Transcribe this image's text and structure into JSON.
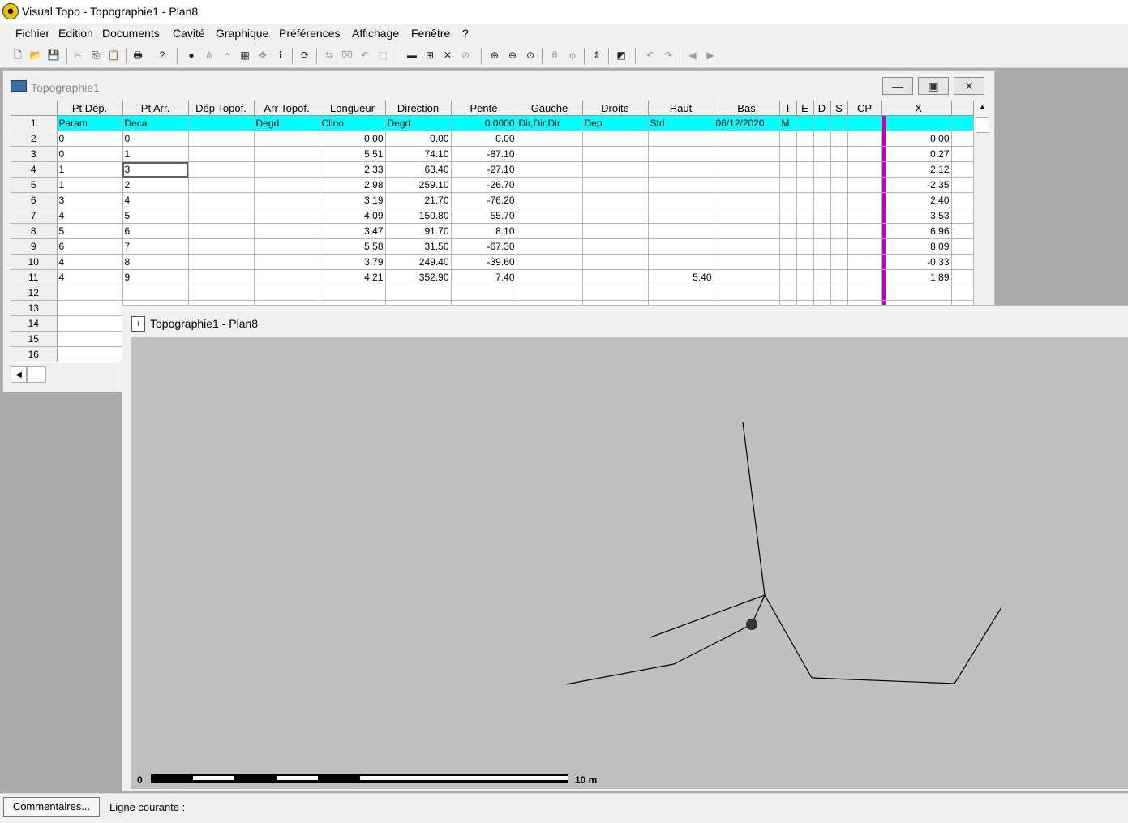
{
  "app": {
    "title": "Visual Topo - Topographie1 - Plan8",
    "icon": "app-logo-icon"
  },
  "menu": [
    "Fichier",
    "Edition",
    "Documents",
    "Cavité",
    "Graphique",
    "Préférences",
    "Affichage",
    "Fenêtre",
    "?"
  ],
  "toolbar_icons": [
    "new-file-icon",
    "open-folder-icon",
    "save-icon",
    "cut-icon",
    "copy-icon",
    "paste-icon",
    "print-icon",
    "help-icon",
    "globe-icon",
    "tree-icon",
    "export-icon",
    "table-icon",
    "move-icon",
    "info-icon",
    "refresh-icon",
    "swap-icon",
    "delete-icon",
    "undo-branch-icon",
    "frame-icon",
    "line-icon",
    "properties-icon",
    "close-x-icon",
    "search-icon",
    "zoom-in-icon",
    "zoom-out-icon",
    "zoom-fit-icon",
    "theta-icon",
    "phi-icon",
    "vertical-arrow-icon",
    "chart-icon",
    "undo-icon",
    "redo-icon",
    "arrow-left-icon",
    "arrow-right-icon"
  ],
  "data_window": {
    "title": "Topographie1",
    "columns": [
      "",
      "Pt Dép.",
      "Pt Arr.",
      "Dép Topof.",
      "Arr Topof.",
      "Longueur",
      "Direction",
      "Pente",
      "Gauche",
      "Droite",
      "Haut",
      "Bas",
      "I",
      "E",
      "D",
      "S",
      "CP",
      "",
      "X",
      ""
    ],
    "rows": [
      {
        "n": "1",
        "dep": "Param",
        "arr": "Deca",
        "dtop": "",
        "atop": "Degd",
        "long": "Clino",
        "dir": "Degd",
        "pente": "0.0000",
        "gauche": "Dir,Dir,Dir",
        "droite": "Dep",
        "haut": "Std",
        "bas": "06/12/2020",
        "i": "M",
        "x": ""
      },
      {
        "n": "2",
        "dep": "0",
        "arr": "0",
        "dtop": "",
        "atop": "",
        "long": "0.00",
        "dir": "0.00",
        "pente": "0.00",
        "gauche": "",
        "droite": "",
        "haut": "",
        "bas": "",
        "i": "",
        "x": "0.00"
      },
      {
        "n": "3",
        "dep": "0",
        "arr": "1",
        "dtop": "",
        "atop": "",
        "long": "5.51",
        "dir": "74.10",
        "pente": "-87.10",
        "gauche": "",
        "droite": "",
        "haut": "",
        "bas": "",
        "i": "",
        "x": "0.27"
      },
      {
        "n": "4",
        "dep": "1",
        "arr": "3",
        "dtop": "",
        "atop": "",
        "long": "2.33",
        "dir": "63.40",
        "pente": "-27.10",
        "gauche": "",
        "droite": "",
        "haut": "",
        "bas": "",
        "i": "",
        "x": "2.12"
      },
      {
        "n": "5",
        "dep": "1",
        "arr": "2",
        "dtop": "",
        "atop": "",
        "long": "2.98",
        "dir": "259.10",
        "pente": "-26.70",
        "gauche": "",
        "droite": "",
        "haut": "",
        "bas": "",
        "i": "",
        "x": "-2.35"
      },
      {
        "n": "6",
        "dep": "3",
        "arr": "4",
        "dtop": "",
        "atop": "",
        "long": "3.19",
        "dir": "21.70",
        "pente": "-76.20",
        "gauche": "",
        "droite": "",
        "haut": "",
        "bas": "",
        "i": "",
        "x": "2.40"
      },
      {
        "n": "7",
        "dep": "4",
        "arr": "5",
        "dtop": "",
        "atop": "",
        "long": "4.09",
        "dir": "150.80",
        "pente": "55.70",
        "gauche": "",
        "droite": "",
        "haut": "",
        "bas": "",
        "i": "",
        "x": "3.53"
      },
      {
        "n": "8",
        "dep": "5",
        "arr": "6",
        "dtop": "",
        "atop": "",
        "long": "3.47",
        "dir": "91.70",
        "pente": "8.10",
        "gauche": "",
        "droite": "",
        "haut": "",
        "bas": "",
        "i": "",
        "x": "6.96"
      },
      {
        "n": "9",
        "dep": "6",
        "arr": "7",
        "dtop": "",
        "atop": "",
        "long": "5.58",
        "dir": "31.50",
        "pente": "-67.30",
        "gauche": "",
        "droite": "",
        "haut": "",
        "bas": "",
        "i": "",
        "x": "8.09"
      },
      {
        "n": "10",
        "dep": "4",
        "arr": "8",
        "dtop": "",
        "atop": "",
        "long": "3.79",
        "dir": "249.40",
        "pente": "-39.60",
        "gauche": "",
        "droite": "",
        "haut": "",
        "bas": "",
        "i": "",
        "x": "-0.33"
      },
      {
        "n": "11",
        "dep": "4",
        "arr": "9",
        "dtop": "",
        "atop": "",
        "long": "4.21",
        "dir": "352.90",
        "pente": "7.40",
        "gauche": "",
        "droite": "",
        "haut": "5.40",
        "bas": "",
        "i": "",
        "x": "1.89"
      },
      {
        "n": "12",
        "dep": "",
        "arr": "",
        "dtop": "",
        "atop": "",
        "long": "",
        "dir": "",
        "pente": "",
        "gauche": "",
        "droite": "",
        "haut": "",
        "bas": "",
        "i": "",
        "x": ""
      },
      {
        "n": "13",
        "dep": "",
        "arr": "",
        "dtop": "",
        "atop": "",
        "long": "",
        "dir": "",
        "pente": "",
        "gauche": "",
        "droite": "",
        "haut": "",
        "bas": "",
        "i": "",
        "x": ""
      },
      {
        "n": "14",
        "dep": "",
        "arr": "",
        "dtop": "",
        "atop": "",
        "long": "",
        "dir": "",
        "pente": "",
        "gauche": "",
        "droite": "",
        "haut": "",
        "bas": "",
        "i": "",
        "x": ""
      },
      {
        "n": "15",
        "dep": "",
        "arr": "",
        "dtop": "",
        "atop": "",
        "long": "",
        "dir": "",
        "pente": "",
        "gauche": "",
        "droite": "",
        "haut": "",
        "bas": "",
        "i": "",
        "x": ""
      },
      {
        "n": "16",
        "dep": "",
        "arr": "",
        "dtop": "",
        "atop": "",
        "long": "",
        "dir": "",
        "pente": "",
        "gauche": "",
        "droite": "",
        "haut": "",
        "bas": "",
        "i": "",
        "x": ""
      }
    ],
    "selected_row": 3,
    "param_color": "#00ffff",
    "marker_color": "#c000c0"
  },
  "plan_window": {
    "title": "Topographie1 - Plan8",
    "scale_start": "0",
    "scale_end": "10 m"
  },
  "status": {
    "comments_button": "Commentaires...",
    "current_line_label": "Ligne courante :"
  }
}
